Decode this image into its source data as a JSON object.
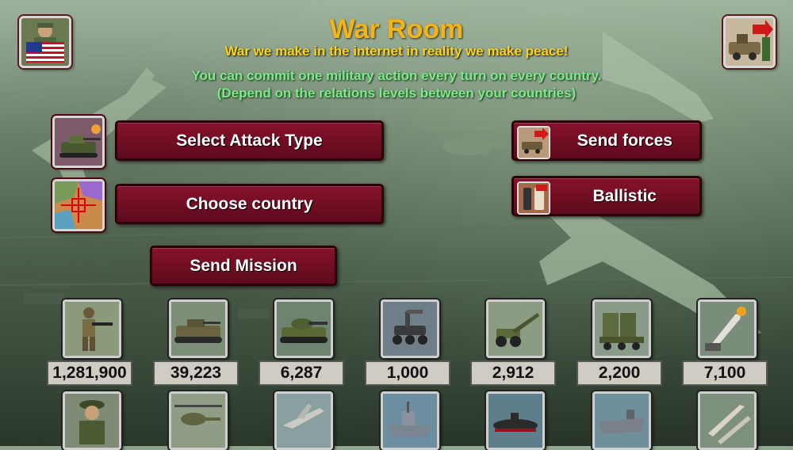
{
  "header": {
    "title": "War Room",
    "subtitle": "War we make in the internet in reality we make peace!",
    "info_line1": "You can commit one military action every turn on every country.",
    "info_line2": "(Depend on the relations levels between your countries)"
  },
  "corner": {
    "player_icon": "general-with-us-flag-icon",
    "exit_icon": "army-vehicle-exit-icon"
  },
  "actions": {
    "select_attack_type": "Select Attack Type",
    "choose_country": "Choose country",
    "send_mission": "Send Mission",
    "send_forces": "Send forces",
    "ballistic": "Ballistic"
  },
  "units_top": [
    {
      "icon": "infantry-soldier-icon",
      "count": "1,281,900"
    },
    {
      "icon": "armored-vehicle-icon",
      "count": "39,223"
    },
    {
      "icon": "tank-icon",
      "count": "6,287"
    },
    {
      "icon": "robot-vehicle-icon",
      "count": "1,000"
    },
    {
      "icon": "artillery-cannon-icon",
      "count": "2,912"
    },
    {
      "icon": "missile-launcher-truck-icon",
      "count": "2,200"
    },
    {
      "icon": "ballistic-missile-icon",
      "count": "7,100"
    }
  ],
  "units_bottom": [
    {
      "icon": "general-officer-icon"
    },
    {
      "icon": "attack-helicopter-icon"
    },
    {
      "icon": "fighter-jet-icon"
    },
    {
      "icon": "warship-icon"
    },
    {
      "icon": "submarine-icon"
    },
    {
      "icon": "aircraft-carrier-icon"
    },
    {
      "icon": "missiles-icon"
    }
  ],
  "colors": {
    "title": "#f3b419",
    "subtitle": "#ffd21a",
    "info": "#7dea8a",
    "button": "#7a1028",
    "count_bg": "#cfccc4"
  }
}
